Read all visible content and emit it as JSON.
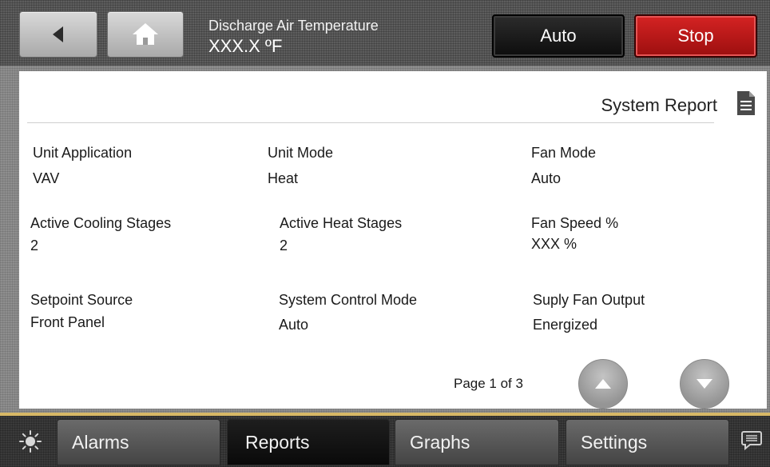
{
  "header": {
    "label": "Discharge Air Temperature",
    "value": "XXX.X ºF",
    "auto_label": "Auto",
    "stop_label": "Stop",
    "back_icon": "back-arrow-icon",
    "home_icon": "home-icon"
  },
  "report": {
    "title": "System Report",
    "icon": "document-icon",
    "fields": [
      {
        "label": "Unit Application",
        "value": "VAV"
      },
      {
        "label": "Unit Mode",
        "value": "Heat"
      },
      {
        "label": "Fan Mode",
        "value": "Auto"
      },
      {
        "label": "Active Cooling Stages",
        "value": "2"
      },
      {
        "label": "Active Heat Stages",
        "value": "2"
      },
      {
        "label": "Fan Speed %",
        "value": "XXX %"
      },
      {
        "label": "Setpoint Source",
        "value": "Front Panel"
      },
      {
        "label": "System Control Mode",
        "value": "Auto"
      },
      {
        "label": "Suply Fan Output",
        "value": "Energized"
      }
    ],
    "page_indicator": "Page 1 of 3"
  },
  "tabs": [
    {
      "label": "Alarms",
      "active": false
    },
    {
      "label": "Reports",
      "active": true
    },
    {
      "label": "Graphs",
      "active": false
    },
    {
      "label": "Settings",
      "active": false
    }
  ],
  "colors": {
    "stop_red": "#c01818",
    "accent_gold": "#d7b866",
    "active_tab": "#111111"
  }
}
